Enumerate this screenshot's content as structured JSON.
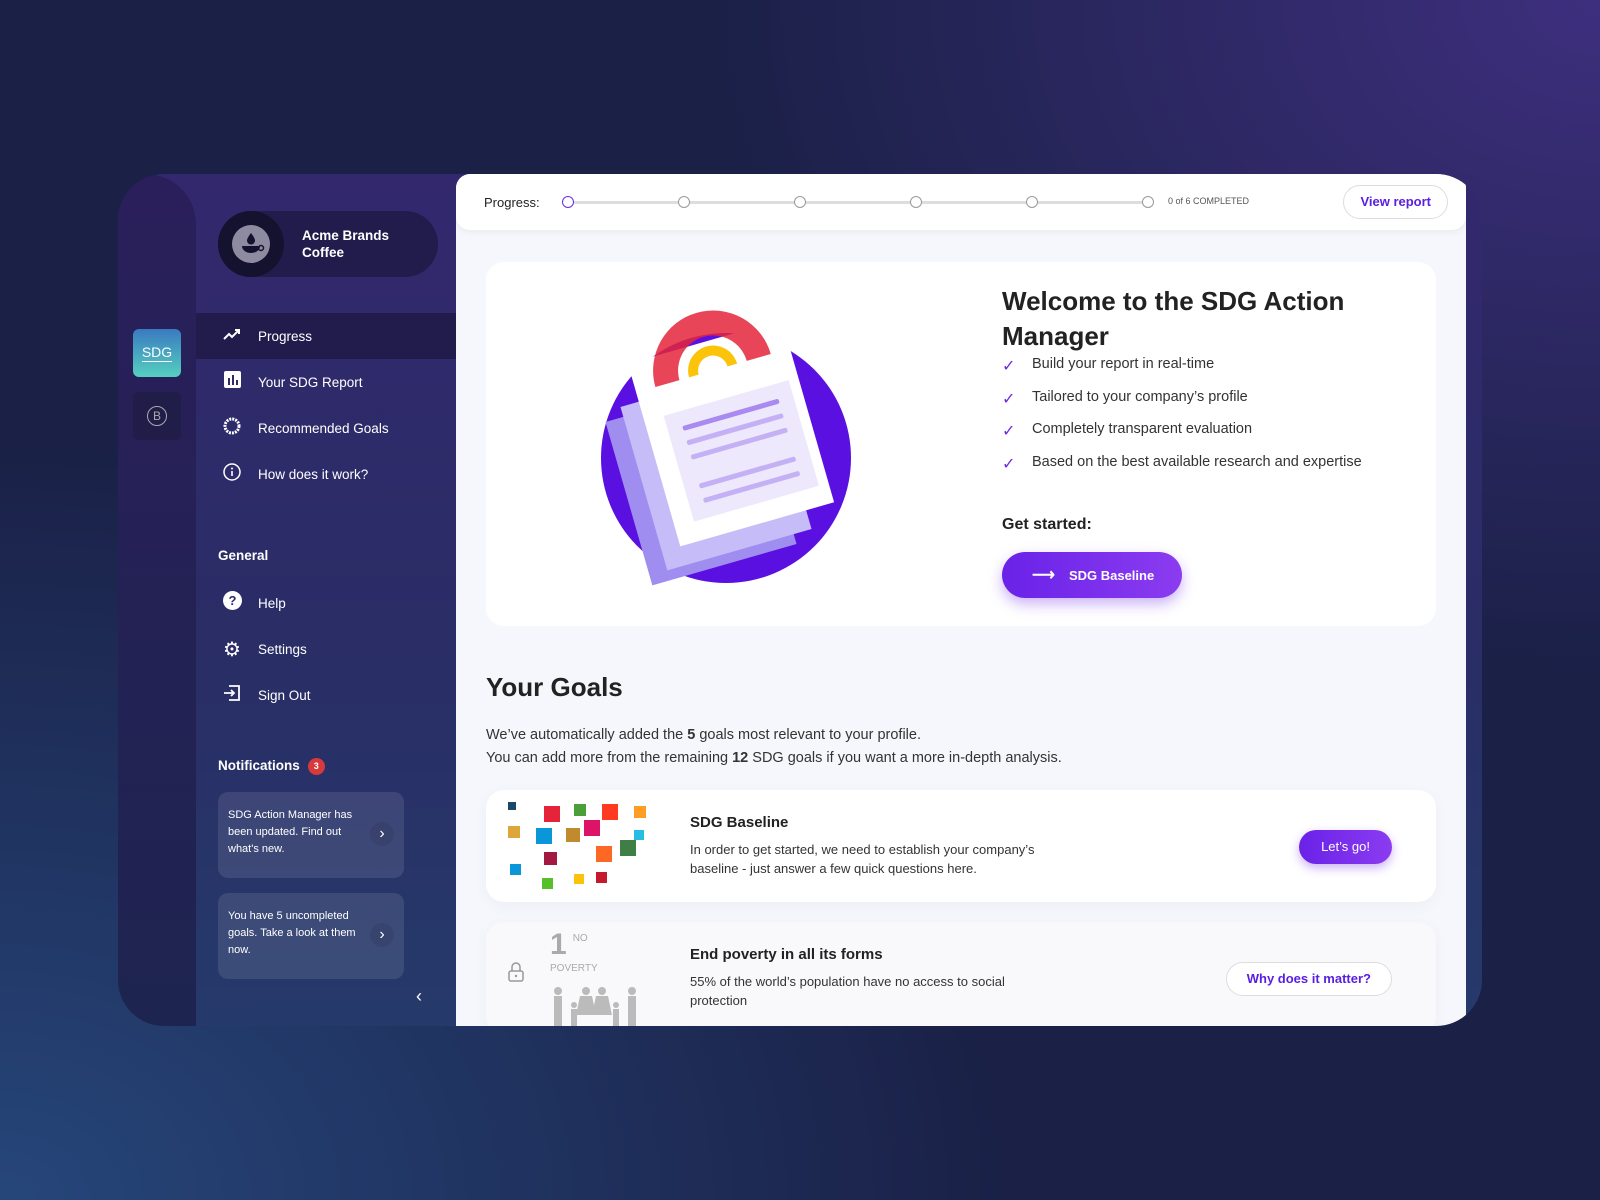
{
  "app": {
    "logo_sdg": "SDG",
    "logo_b": "B"
  },
  "org": {
    "name": "Acme Brands Coffee"
  },
  "nav": [
    {
      "label": "Progress",
      "icon": "trending-up-icon",
      "active": true
    },
    {
      "label": "Your SDG Report",
      "icon": "bar-chart-icon"
    },
    {
      "label": "Recommended Goals",
      "icon": "sdg-wheel-icon"
    },
    {
      "label": "How does it work?",
      "icon": "info-icon"
    }
  ],
  "general": {
    "title": "General",
    "items": [
      {
        "label": "Help",
        "icon": "help-icon"
      },
      {
        "label": "Settings",
        "icon": "gear-icon"
      },
      {
        "label": "Sign Out",
        "icon": "sign-out-icon"
      }
    ]
  },
  "notifications": {
    "title": "Notifications",
    "count": "3",
    "items": [
      {
        "text": "SDG Action Manager has been updated. Find out what's new."
      },
      {
        "text": "You have 5 uncompleted goals. Take a look at them now."
      }
    ]
  },
  "progress": {
    "label": "Progress:",
    "steps_total": 6,
    "completed": 0,
    "status": "0 of 6 COMPLETED",
    "view_report": "View report"
  },
  "welcome": {
    "title": "Welcome to the SDG Action Manager",
    "bullets": [
      "Build your report in real-time",
      "Tailored to your company’s profile",
      "Completely transparent evaluation",
      "Based on the best available research and expertise"
    ],
    "get_started": "Get started:",
    "cta": "SDG Baseline"
  },
  "goals": {
    "title": "Your Goals",
    "intro1_pre": "We’ve automatically added the ",
    "intro1_num": "5",
    "intro1_post": " goals most relevant to your profile.",
    "intro2_pre": "You can add more from the remaining ",
    "intro2_num": "12",
    "intro2_post": " SDG goals if you want a more in-depth analysis.",
    "cards": [
      {
        "title": "SDG Baseline",
        "text": "In order to get started, we need to establish your company’s baseline - just answer a few quick questions here.",
        "button": "Let’s go!"
      },
      {
        "title": "End poverty in all its forms",
        "text": "55% of the world’s population have no access to social protection",
        "button": "Why does it matter?",
        "badge_num": "1",
        "badge_text": "NO POVERTY",
        "locked": true
      }
    ]
  },
  "colors": {
    "accent": "#6b2be0",
    "sidebar": "#2f2a6a",
    "badge": "#d63a3a"
  }
}
